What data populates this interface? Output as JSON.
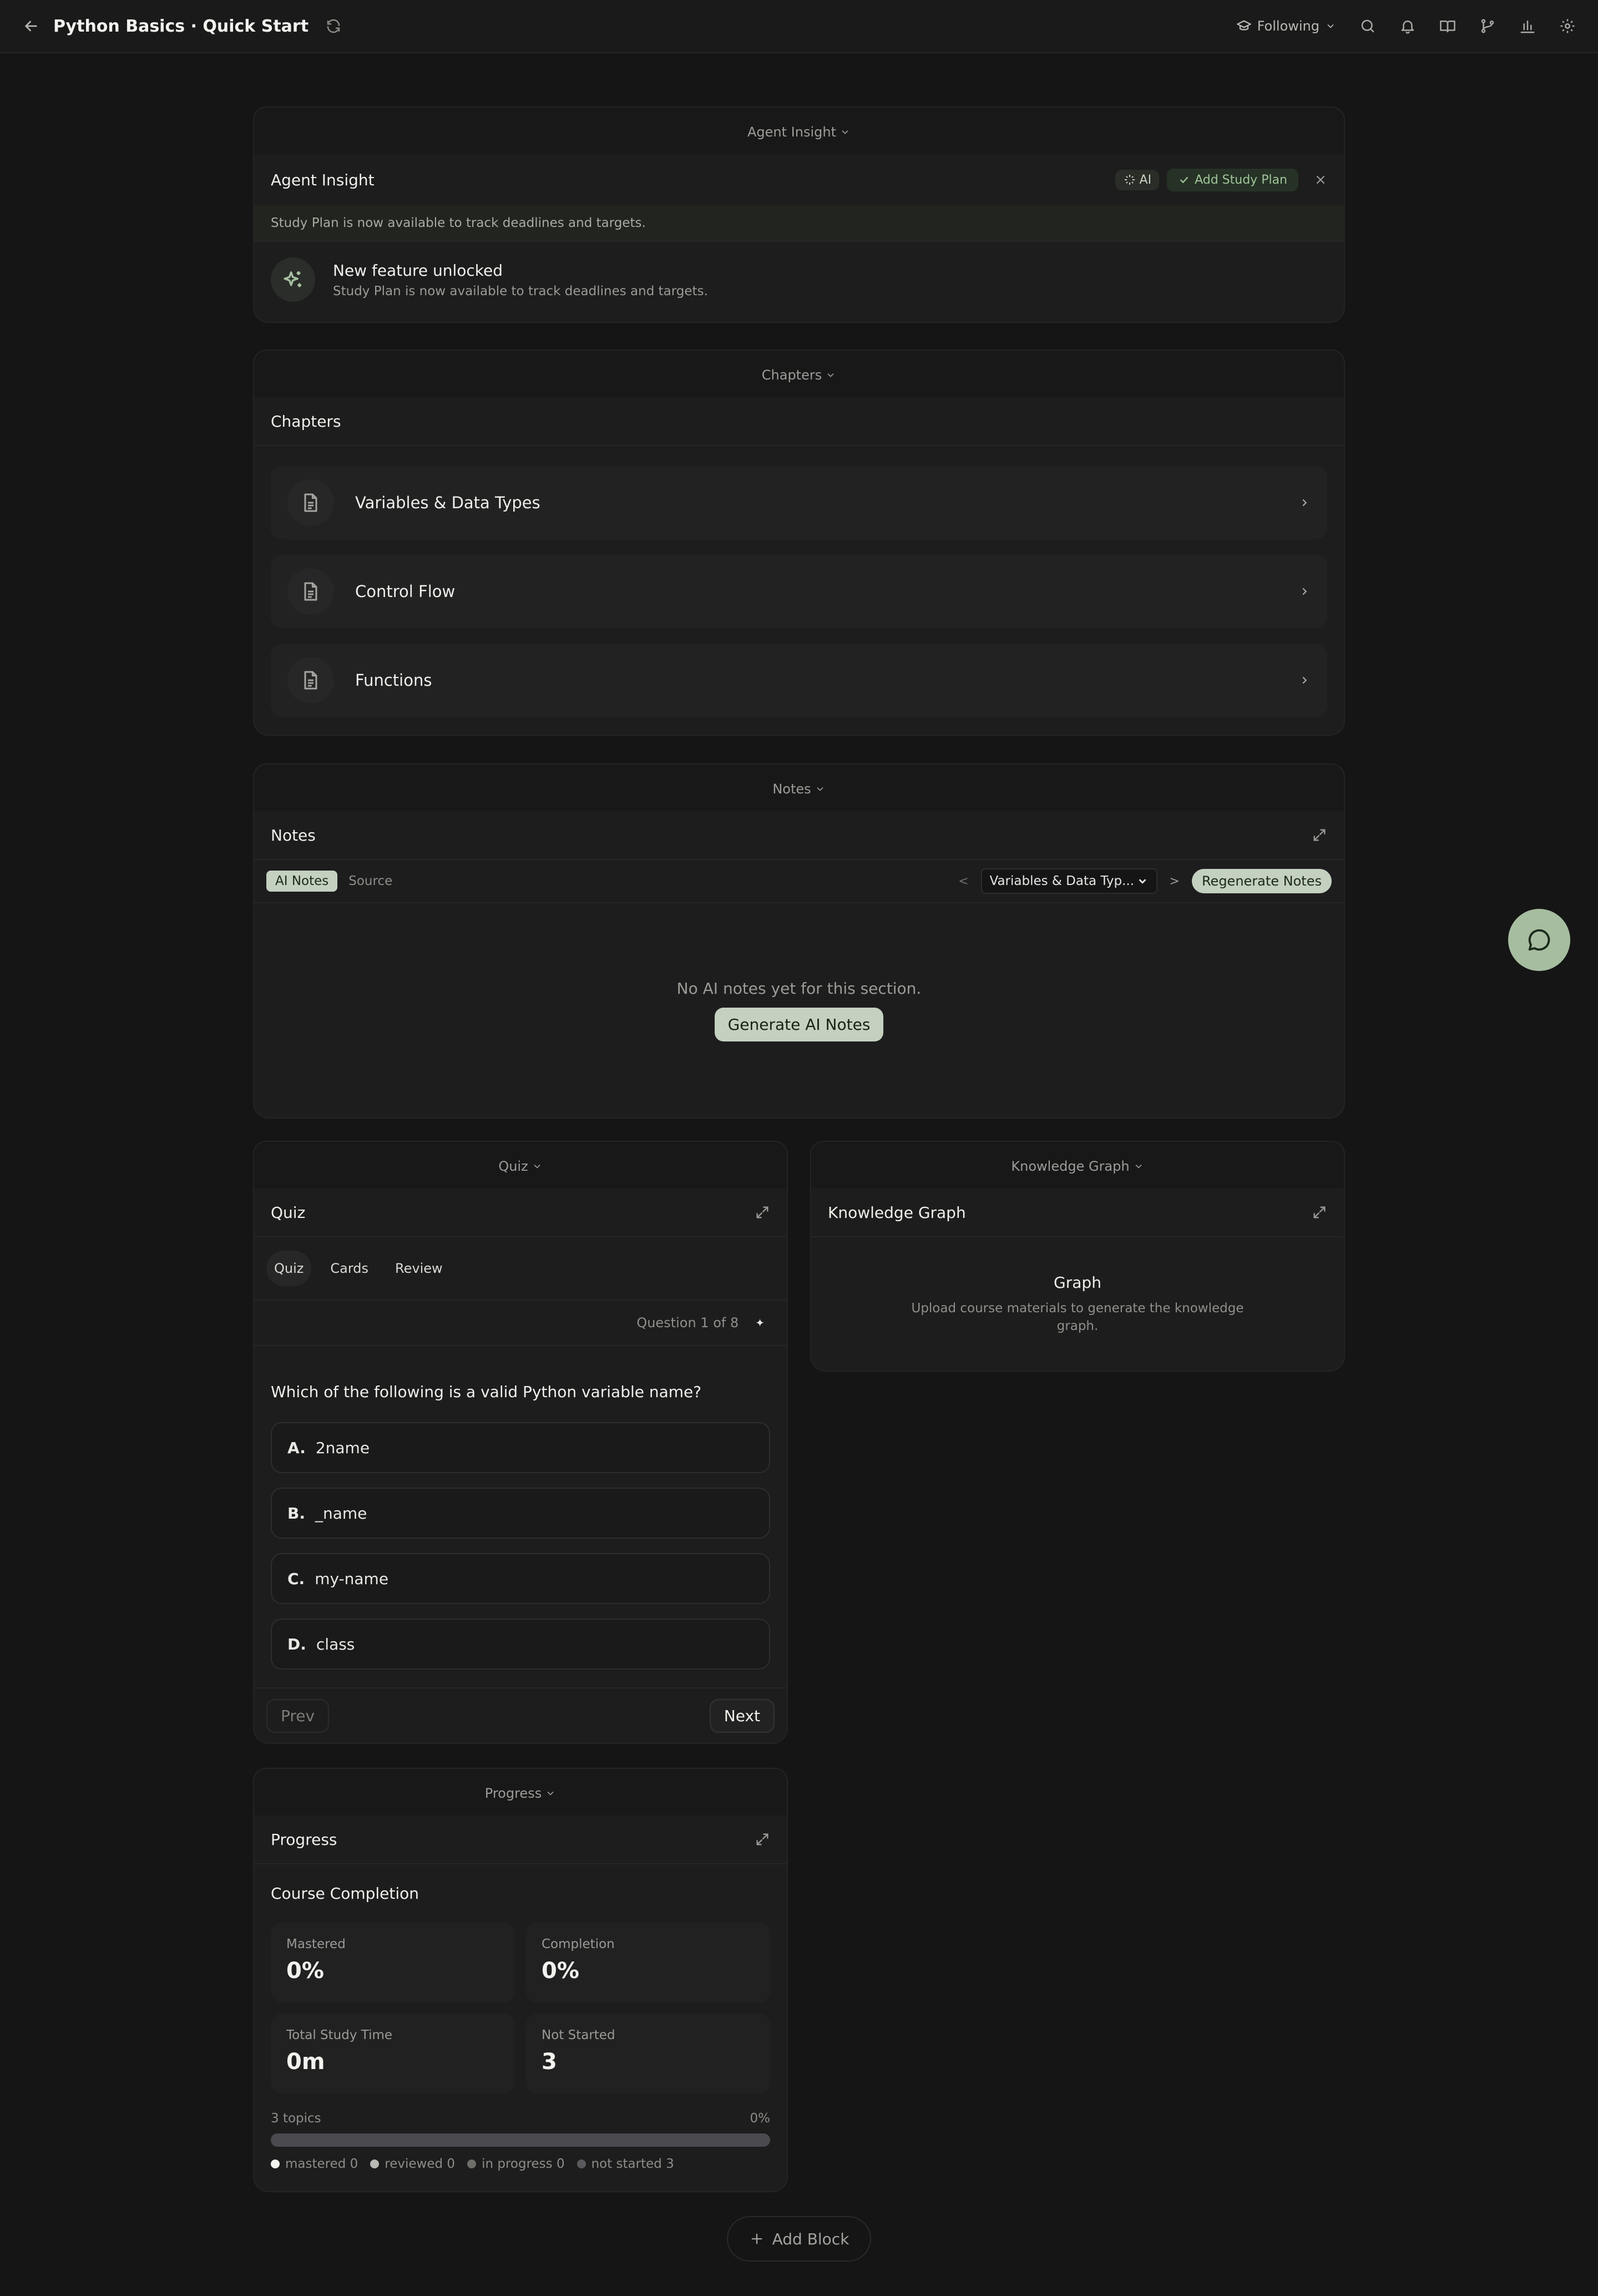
{
  "header": {
    "title": "Python Basics · Quick Start",
    "following_label": "Following"
  },
  "agent_insight": {
    "tab_label": "Agent Insight",
    "title": "Agent Insight",
    "ai_badge": "AI",
    "add_plan_label": "Add Study Plan",
    "strip_text": "Study Plan is now available to track deadlines and targets.",
    "item_title": "New feature unlocked",
    "item_subtitle": "Study Plan is now available to track deadlines and targets."
  },
  "chapters": {
    "tab_label": "Chapters",
    "title": "Chapters",
    "items": [
      {
        "label": "Variables & Data Types"
      },
      {
        "label": "Control Flow"
      },
      {
        "label": "Functions"
      }
    ]
  },
  "notes": {
    "tab_label": "Notes",
    "title": "Notes",
    "tab_ai": "AI Notes",
    "tab_source": "Source",
    "prev_arrow": "<",
    "next_arrow": ">",
    "selected_section": "Variables & Data Typ...",
    "regenerate_label": "Regenerate Notes",
    "empty_message": "No AI notes yet for this section.",
    "generate_label": "Generate AI Notes"
  },
  "quiz": {
    "tab_label": "Quiz",
    "title": "Quiz",
    "tabs": [
      "Quiz",
      "Cards",
      "Review"
    ],
    "counter": "Question 1 of 8",
    "question": "Which of the following is a valid Python variable name?",
    "options": [
      {
        "letter": "A.",
        "text": "2name"
      },
      {
        "letter": "B.",
        "text": "_name"
      },
      {
        "letter": "C.",
        "text": "my-name"
      },
      {
        "letter": "D.",
        "text": "class"
      }
    ],
    "prev_label": "Prev",
    "next_label": "Next"
  },
  "knowledge_graph": {
    "tab_label": "Knowledge Graph",
    "title": "Knowledge Graph",
    "heading": "Graph",
    "subtitle": "Upload course materials to generate the knowledge graph."
  },
  "progress": {
    "tab_label": "Progress",
    "title": "Progress",
    "section_title": "Course Completion",
    "stats": [
      {
        "label": "Mastered",
        "value": "0%"
      },
      {
        "label": "Completion",
        "value": "0%"
      },
      {
        "label": "Total Study Time",
        "value": "0m"
      },
      {
        "label": "Not Started",
        "value": "3"
      }
    ],
    "topics_label": "3 topics",
    "percent_label": "0%",
    "completion_fraction": 0,
    "legend": [
      {
        "label": "mastered 0",
        "color": "#f2f2ee"
      },
      {
        "label": "reviewed 0",
        "color": "#b9b9b5"
      },
      {
        "label": "in progress 0",
        "color": "#6e6e6a"
      },
      {
        "label": "not started 3",
        "color": "#5a5a5e"
      }
    ]
  },
  "add_block_label": "Add Block",
  "colors": {
    "accent": "#c4d0c0",
    "background": "#151515",
    "card": "#1d1d1d",
    "fab": "#a6bda0"
  }
}
